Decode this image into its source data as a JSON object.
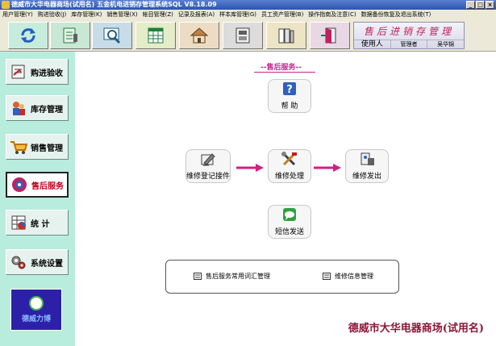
{
  "window": {
    "title": "德威市大华电器商场(试用名) 五金机电进销存管理系统SQL V8.18.09",
    "controls": [
      "_",
      "□",
      "×"
    ]
  },
  "menu": [
    "用户管理(Y)",
    "购进验收(J)",
    "库存管理(K)",
    "销售管理(X)",
    "帐目管理(Z)",
    "记录及报表(A)",
    "样本库管理(G)",
    "员工资产管理(B)",
    "操作指南及注意(C)",
    "数据备份恢复及退出系统(T)"
  ],
  "toolbar": {
    "buttons": [
      {
        "icon": "refresh-icon",
        "color": "#2060c0"
      },
      {
        "icon": "ledger-icon",
        "color": "#208040"
      },
      {
        "icon": "magnifier-icon",
        "color": "#206080"
      },
      {
        "icon": "spreadsheet-icon",
        "color": "#208040"
      },
      {
        "icon": "house-icon",
        "color": "#806020"
      },
      {
        "icon": "cabinet-icon",
        "color": "#404040"
      },
      {
        "icon": "books-icon",
        "color": "#404040"
      },
      {
        "icon": "exit-door-icon",
        "color": "#c02060"
      }
    ],
    "logo": {
      "title": "售后进销存管理",
      "user_label": "使用人",
      "role": "管理者",
      "user_name": "吴华锦"
    }
  },
  "sidebar": {
    "items": [
      {
        "label": "购进验收",
        "icon": "purchase-receive-icon",
        "active": false
      },
      {
        "label": "库存管理",
        "icon": "inventory-icon",
        "active": false
      },
      {
        "label": "销售管理",
        "icon": "cart-icon",
        "active": false
      },
      {
        "label": "售后服务",
        "icon": "after-sales-icon",
        "active": true
      },
      {
        "label": "统 计",
        "icon": "statistics-icon",
        "active": false
      },
      {
        "label": "系统设置",
        "icon": "settings-icon",
        "active": false
      }
    ],
    "brand": {
      "name": "德威力博"
    }
  },
  "main": {
    "section_title": "--售后服务--",
    "functions": {
      "help": "帮 助",
      "register": "维修登记接件",
      "process": "维修处理",
      "dispatch": "维修发出",
      "sms": "短信发送"
    },
    "management": {
      "terms": "售后服务常用词汇管理",
      "info": "维修信息管理"
    },
    "company": "德威市大华电器商场(试用名)"
  },
  "colors": {
    "accent_pink": "#cc2090",
    "sidebar_bg": "#b8ecdc",
    "title_bar": "#2c55b0",
    "company_text": "#8a1838"
  }
}
